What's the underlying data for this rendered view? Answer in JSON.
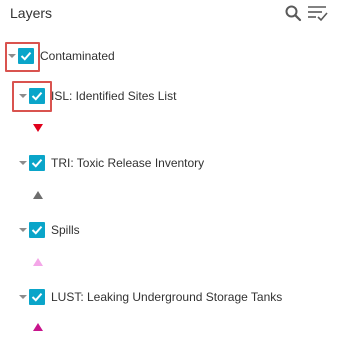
{
  "panel": {
    "title": "Layers",
    "search_icon": "search-icon",
    "filter_icon": "filter-list-icon"
  },
  "layers": [
    {
      "label": "Contaminated",
      "checked": true,
      "expanded": true,
      "highlighted": true
    },
    {
      "label": "ISL: Identified Sites List",
      "checked": true,
      "expanded": true,
      "highlighted": true,
      "symbol": {
        "shape": "triangle-down",
        "color": "#e0001b"
      }
    },
    {
      "label": "TRI: Toxic Release Inventory",
      "checked": true,
      "expanded": true,
      "highlighted": false,
      "symbol": {
        "shape": "triangle-up",
        "color": "#6e6e6e"
      }
    },
    {
      "label": "Spills",
      "checked": true,
      "expanded": true,
      "highlighted": false,
      "symbol": {
        "shape": "triangle-up",
        "color": "#f4a6e8"
      }
    },
    {
      "label": "LUST: Leaking Underground Storage Tanks",
      "checked": true,
      "expanded": true,
      "highlighted": false,
      "symbol": {
        "shape": "triangle-up",
        "color": "#c8148c"
      }
    }
  ],
  "colors": {
    "checkbox": "#0aa5c9",
    "highlight": "#d9534f",
    "text": "#323232"
  }
}
